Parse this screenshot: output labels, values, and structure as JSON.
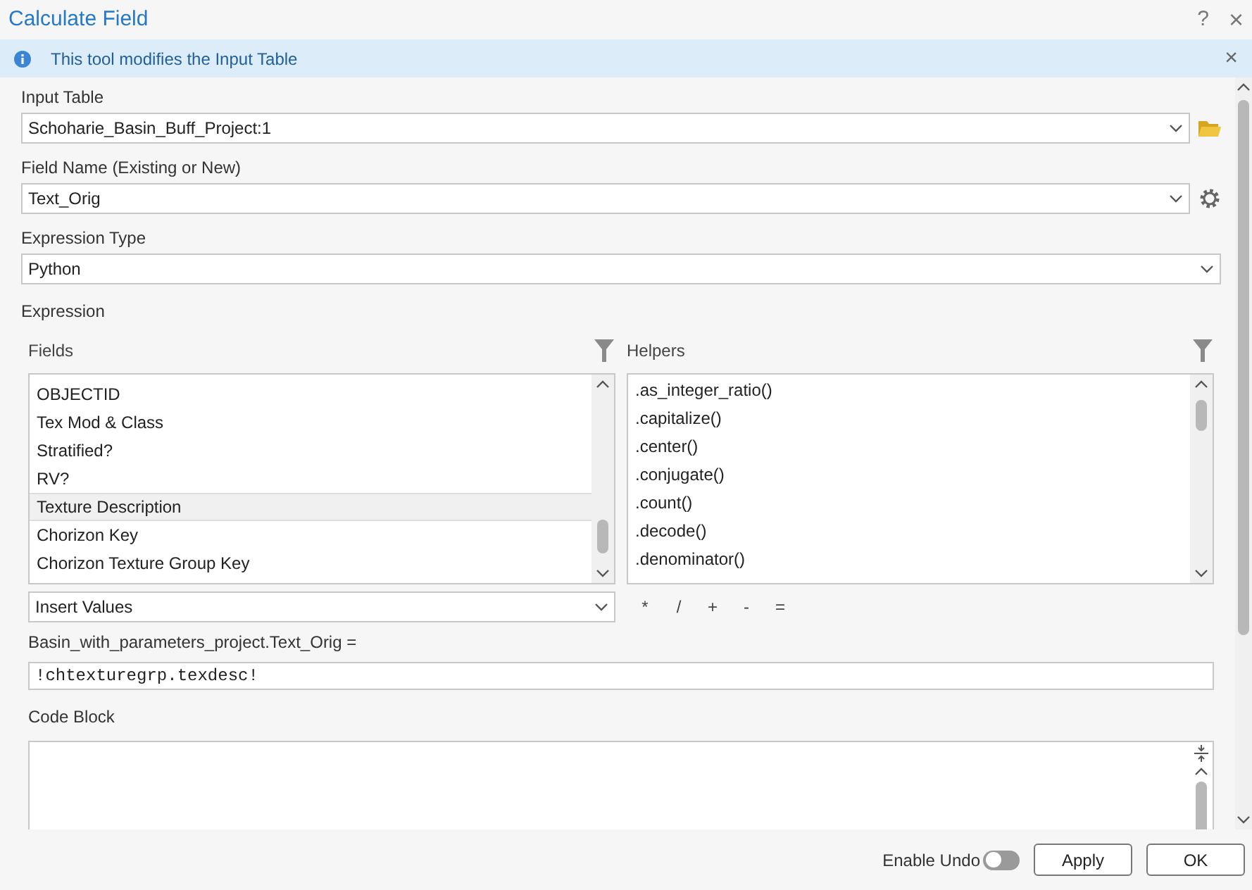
{
  "window": {
    "title": "Calculate Field",
    "help": "?",
    "close": "×"
  },
  "info_bar": {
    "message": "This tool modifies the Input Table",
    "close": "×"
  },
  "input_table": {
    "label": "Input Table",
    "value": "Schoharie_Basin_Buff_Project:1"
  },
  "field_name": {
    "label": "Field Name (Existing or New)",
    "value": "Text_Orig"
  },
  "expression_type": {
    "label": "Expression Type",
    "value": "Python"
  },
  "expression": {
    "label": "Expression",
    "fields": {
      "label": "Fields",
      "items": [
        {
          "label": "OBJECTID",
          "selected": false
        },
        {
          "label": "Tex Mod & Class",
          "selected": false
        },
        {
          "label": "Stratified?",
          "selected": false
        },
        {
          "label": "RV?",
          "selected": false
        },
        {
          "label": "Texture Description",
          "selected": true
        },
        {
          "label": "Chorizon Key",
          "selected": false
        },
        {
          "label": "Chorizon Texture Group Key",
          "selected": false
        }
      ]
    },
    "helpers": {
      "label": "Helpers",
      "items": [
        ".as_integer_ratio()",
        ".capitalize()",
        ".center()",
        ".conjugate()",
        ".count()",
        ".decode()",
        ".denominator()"
      ]
    },
    "insert_values": "Insert Values",
    "operators": [
      "*",
      "/",
      "+",
      "-",
      "="
    ],
    "target_label": "Basin_with_parameters_project.Text_Orig =",
    "value": "!chtexturegrp.texdesc!"
  },
  "code_block": {
    "label": "Code Block"
  },
  "footer": {
    "enable_undo": {
      "label": "Enable Undo",
      "on": false
    },
    "buttons": [
      "Apply",
      "OK"
    ]
  }
}
